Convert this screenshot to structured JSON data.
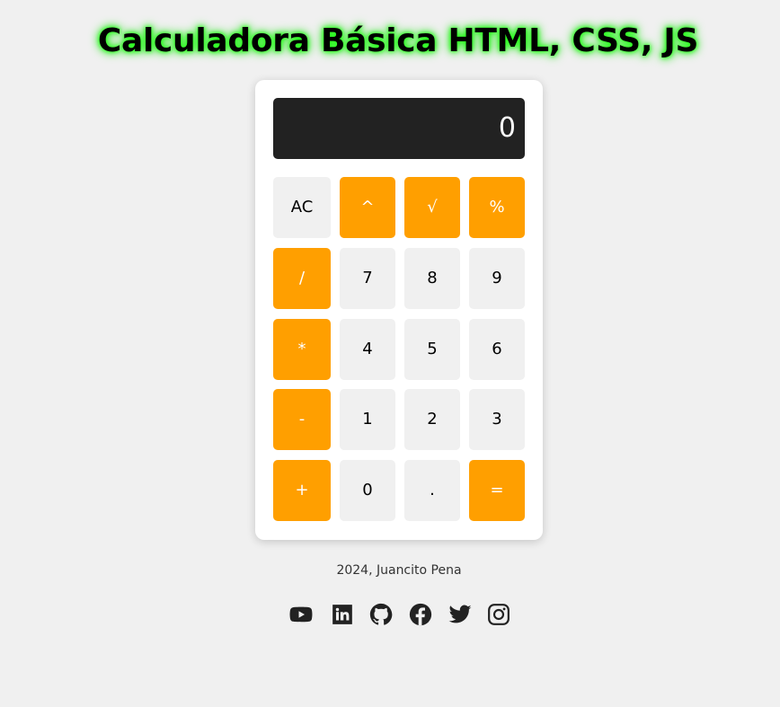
{
  "page": {
    "title": "Calculadora Básica HTML, CSS, JS",
    "footer": "2024, Juancito Pena"
  },
  "calculator": {
    "display_value": "0",
    "keys": [
      {
        "label": "AC",
        "kind": "fn"
      },
      {
        "label": "^",
        "kind": "op"
      },
      {
        "label": "√",
        "kind": "op"
      },
      {
        "label": "%",
        "kind": "op"
      },
      {
        "label": "/",
        "kind": "op"
      },
      {
        "label": "7",
        "kind": "num"
      },
      {
        "label": "8",
        "kind": "num"
      },
      {
        "label": "9",
        "kind": "num"
      },
      {
        "label": "*",
        "kind": "op"
      },
      {
        "label": "4",
        "kind": "num"
      },
      {
        "label": "5",
        "kind": "num"
      },
      {
        "label": "6",
        "kind": "num"
      },
      {
        "label": "-",
        "kind": "op"
      },
      {
        "label": "1",
        "kind": "num"
      },
      {
        "label": "2",
        "kind": "num"
      },
      {
        "label": "3",
        "kind": "num"
      },
      {
        "label": "+",
        "kind": "op"
      },
      {
        "label": "0",
        "kind": "num"
      },
      {
        "label": ".",
        "kind": "num"
      },
      {
        "label": "=",
        "kind": "op"
      }
    ]
  },
  "socials": [
    {
      "icon": "youtube-icon"
    },
    {
      "icon": "linkedin-icon"
    },
    {
      "icon": "github-icon"
    },
    {
      "icon": "facebook-icon"
    },
    {
      "icon": "twitter-icon"
    },
    {
      "icon": "instagram-icon"
    }
  ],
  "colors": {
    "accent": "#ff9f00",
    "display_bg": "#222222",
    "key_bg": "#f0f0f0",
    "title_glow": "#26ff1a",
    "page_bg": "#f0f0f0"
  }
}
